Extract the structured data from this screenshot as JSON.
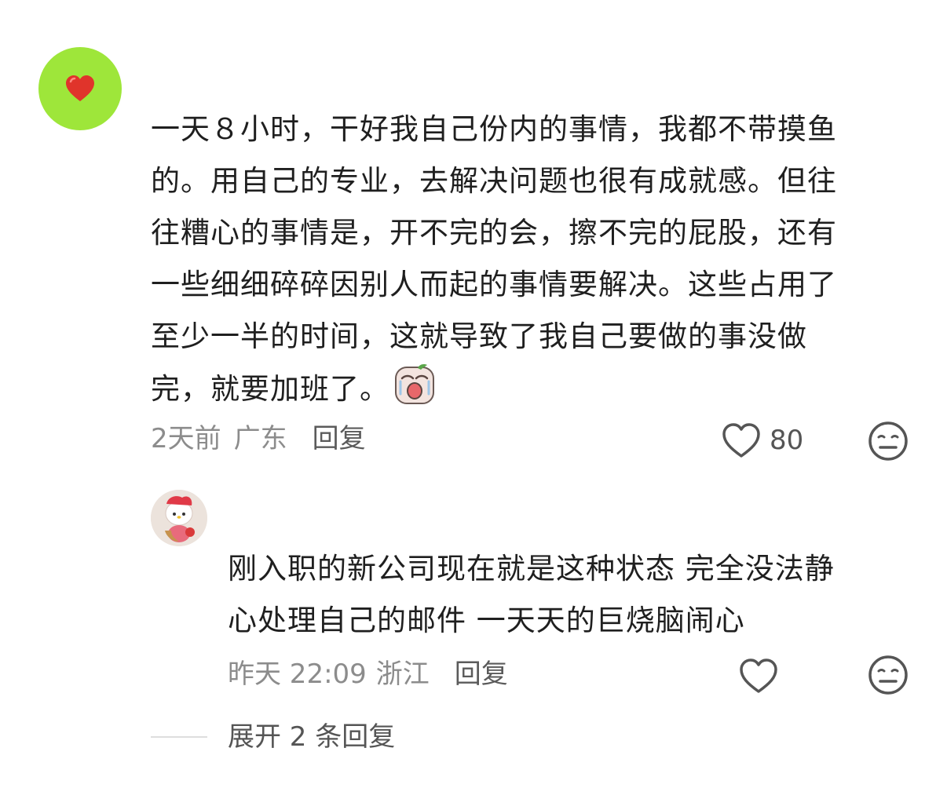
{
  "comment": {
    "lines": [
      "一天８小时，干好我自己份内的事情，我都不带摸鱼",
      "的。用自己的专业，去解决问题也很有成就感。但往",
      "往糟心的事情是，开不完的会，擦不完的屁股，还有",
      "一些细细碎碎因别人而起的事情要解决。这些占用了",
      "至少一半的时间，这就导致了我自己要做的事没做",
      "完，就要加班了。"
    ],
    "time": "2天前",
    "location": "广东",
    "reply_label": "回复",
    "like_count": "80",
    "emoji": "crying-sticker"
  },
  "reply": {
    "lines": [
      "刚入职的新公司现在就是这种状态 完全没法静",
      "心处理自己的邮件 一天天的巨烧脑闹心"
    ],
    "time": "昨天 22:09",
    "location": "浙江",
    "reply_label": "回复"
  },
  "expand_label": "展开 2 条回复",
  "colors": {
    "avatar_green": "#9ee63a",
    "heart_red": "#e0342b",
    "meta_gray": "#8c8c8c"
  }
}
